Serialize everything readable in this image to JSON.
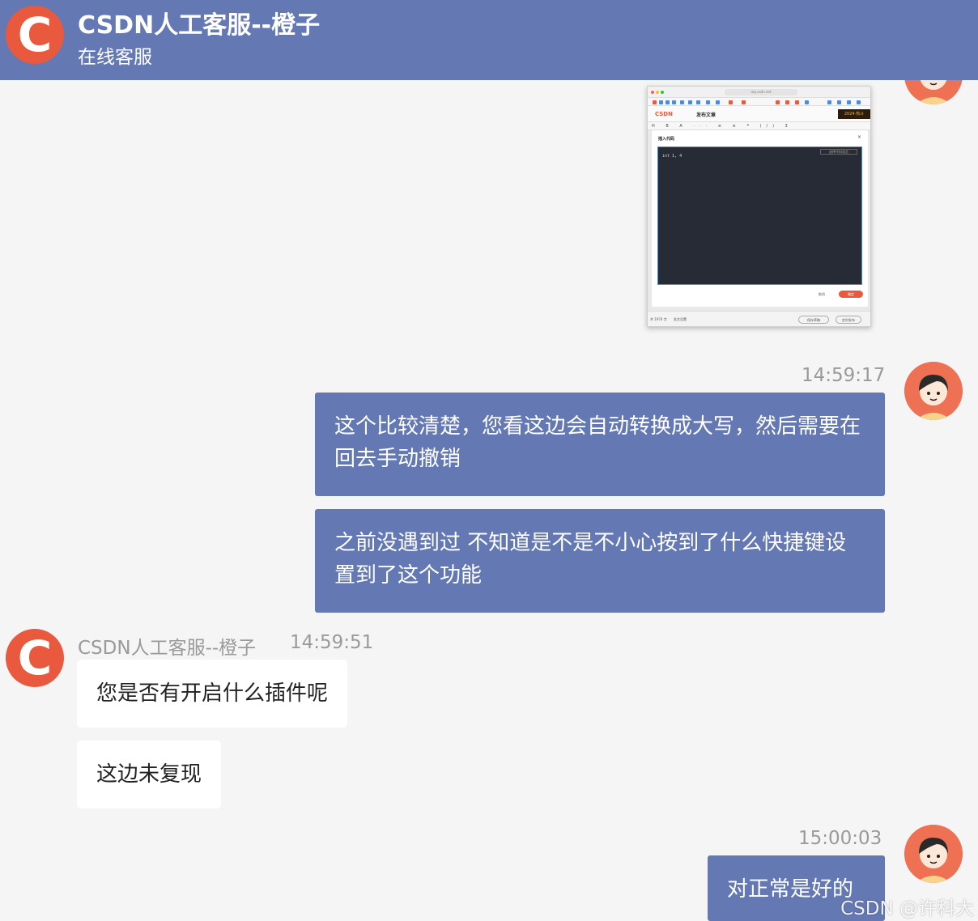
{
  "header": {
    "title": "CSDN人工客服--橙子",
    "subtitle": "在线客服",
    "avatar_letter": "C"
  },
  "colors": {
    "header_bg": "#6479b4",
    "user_bubble_bg": "#6479b4",
    "agent_bubble_bg": "#ffffff",
    "chat_bg": "#f5f5f5",
    "brand_orange": "#e8593d"
  },
  "screenshot_thumb": {
    "url": "mp.csdn.net",
    "logo": "CSDN",
    "nav_title": "发布文章",
    "banner": "2024·热斗",
    "toolbar": "H B A ··· ≡ ≡ ❝ ⟨/⟩ Σ",
    "modal_title": "插入代码",
    "modal_close": "×",
    "code_language_placeholder": "选择代码语言",
    "code_text": "int 1, 4",
    "cancel_label": "取消",
    "confirm_label": "确定",
    "footer_wordcount": "共 1974 字",
    "footer_settings": "发文设置",
    "footer_save_draft": "保存草稿",
    "footer_schedule": "定时发布"
  },
  "messages": [
    {
      "time": "14:59:17",
      "side": "user",
      "texts": [
        "这个比较清楚，您看这边会自动转换成大写，然后需要在回去手动撤销",
        "之前没遇到过 不知道是不是不小心按到了什么快捷键设置到了这个功能"
      ]
    },
    {
      "agent_name": "CSDN人工客服--橙子",
      "time": "14:59:51",
      "side": "agent",
      "texts": [
        "您是否有开启什么插件呢",
        "这边未复现"
      ]
    },
    {
      "time": "15:00:03",
      "side": "user",
      "texts": [
        "对正常是好的"
      ]
    }
  ],
  "watermark": "CSDN @许科大"
}
